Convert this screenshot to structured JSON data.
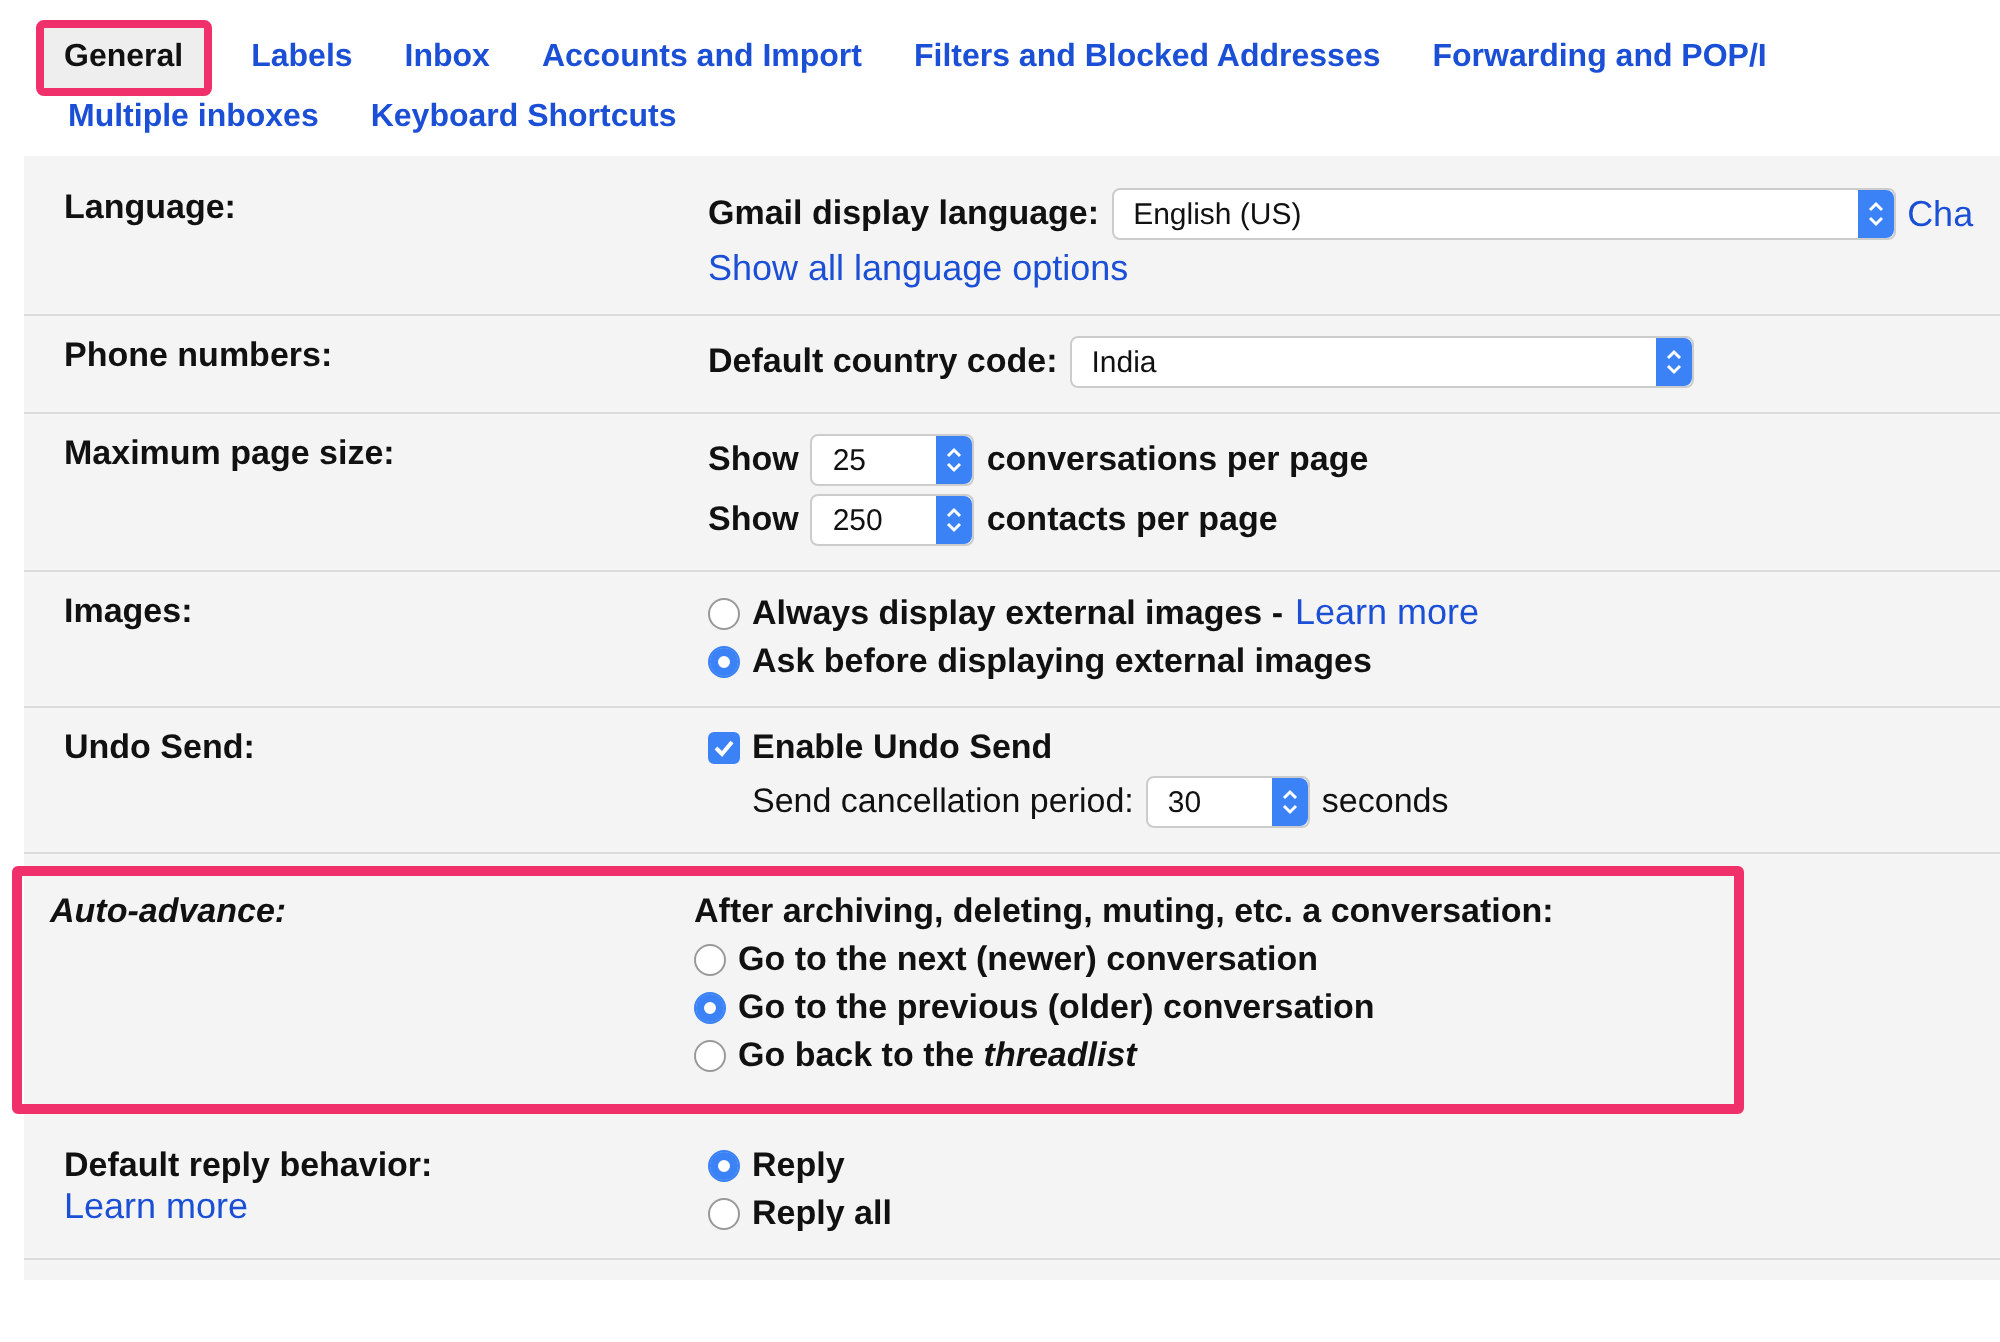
{
  "tab_rows": [
    {
      "tabs": [
        {
          "label": "General",
          "selected": true,
          "highlighted": true
        },
        {
          "label": "Labels",
          "selected": false,
          "highlighted": false
        },
        {
          "label": "Inbox",
          "selected": false,
          "highlighted": false
        },
        {
          "label": "Accounts and Import",
          "selected": false,
          "highlighted": false
        },
        {
          "label": "Filters and Blocked Addresses",
          "selected": false,
          "highlighted": false
        },
        {
          "label": "Forwarding and POP/I",
          "selected": false,
          "highlighted": false
        }
      ]
    },
    {
      "tabs": [
        {
          "label": "Multiple inboxes",
          "selected": false,
          "highlighted": false
        },
        {
          "label": "Keyboard Shortcuts",
          "selected": false,
          "highlighted": false
        }
      ]
    }
  ],
  "sections": [
    {
      "label": "Language:",
      "highlighted": false,
      "lines": [
        {
          "kind": "language_select",
          "prefix": "Gmail display language:",
          "value": "English (US)",
          "after_link": "Cha"
        },
        {
          "kind": "link",
          "text": "Show all language options"
        }
      ]
    },
    {
      "label": "Phone numbers:",
      "highlighted": false,
      "lines": [
        {
          "kind": "country_select",
          "prefix": "Default country code:",
          "value": "India"
        }
      ]
    },
    {
      "label": "Maximum page size:",
      "highlighted": false,
      "lines": [
        {
          "kind": "count_select",
          "prefix": "Show",
          "value": "25",
          "suffix": "conversations per page"
        },
        {
          "kind": "count_select",
          "prefix": "Show",
          "value": "250",
          "suffix": "contacts per page"
        }
      ]
    },
    {
      "label": "Images:",
      "highlighted": false,
      "lines": [
        {
          "kind": "radio",
          "text": "Always display external images -",
          "link": "Learn more",
          "selected": false
        },
        {
          "kind": "radio",
          "text": "Ask before displaying external images",
          "selected": true
        }
      ]
    },
    {
      "label": "Undo Send:",
      "highlighted": false,
      "lines": [
        {
          "kind": "checkbox",
          "text": "Enable Undo Send",
          "checked": true
        },
        {
          "kind": "period_select",
          "prefix": "Send cancellation period:",
          "value": "30",
          "suffix": "seconds"
        }
      ]
    },
    {
      "label": "Auto-advance:",
      "highlighted": true,
      "lines": [
        {
          "kind": "text",
          "text": "After archiving, deleting, muting, etc. a conversation:"
        },
        {
          "kind": "radio",
          "text": "Go to the next (newer) conversation",
          "selected": false
        },
        {
          "kind": "radio",
          "text": "Go to the previous (older) conversation",
          "selected": true
        },
        {
          "kind": "radio",
          "text": "Go back to the *threadlist*",
          "selected": false
        }
      ]
    },
    {
      "label": "Default reply behavior:",
      "label_link": "Learn more",
      "highlighted": false,
      "lines": [
        {
          "kind": "radio",
          "text": "Reply",
          "selected": true
        },
        {
          "kind": "radio",
          "text": "Reply all",
          "selected": false
        }
      ]
    }
  ]
}
